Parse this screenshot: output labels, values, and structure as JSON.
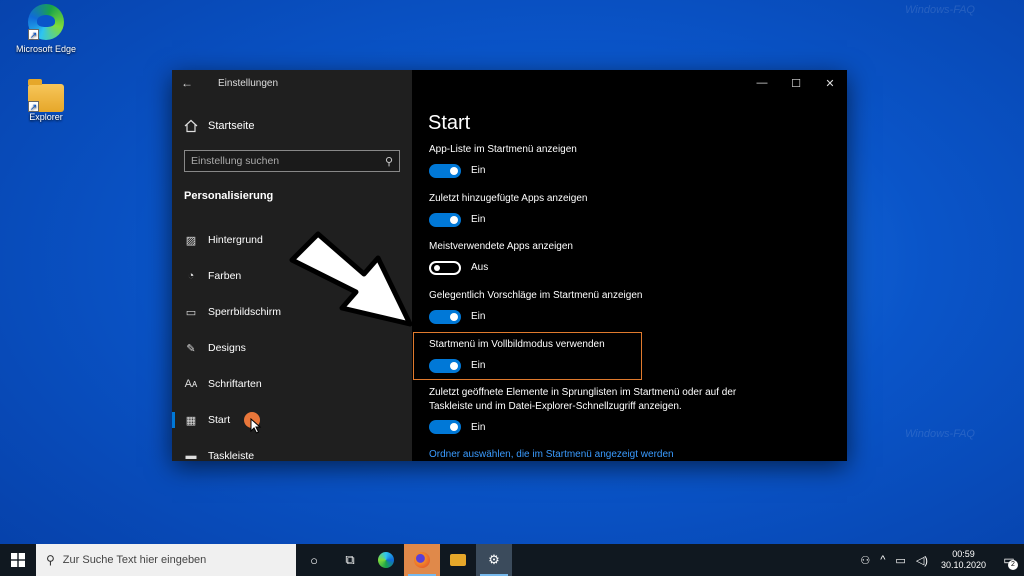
{
  "desktop": {
    "icons": [
      {
        "label": "Microsoft Edge"
      },
      {
        "label": "Explorer"
      }
    ],
    "watermark": "Windows-FAQ"
  },
  "window": {
    "title": "Einstellungen",
    "controls": {
      "minimize": "—",
      "maximize": "☐",
      "close": "✕"
    }
  },
  "sidebar": {
    "home_label": "Startseite",
    "search_placeholder": "Einstellung suchen",
    "section_title": "Personalisierung",
    "items": [
      {
        "label": "Hintergrund",
        "icon": "image-icon"
      },
      {
        "label": "Farben",
        "icon": "palette-icon"
      },
      {
        "label": "Sperrbildschirm",
        "icon": "lock-screen-icon"
      },
      {
        "label": "Designs",
        "icon": "brush-icon"
      },
      {
        "label": "Schriftarten",
        "icon": "font-icon"
      },
      {
        "label": "Start",
        "icon": "start-icon",
        "active": true
      },
      {
        "label": "Taskleiste",
        "icon": "taskbar-icon"
      }
    ]
  },
  "content": {
    "page_title": "Start",
    "settings": [
      {
        "label": "App-Liste im Startmenü anzeigen",
        "state": "Ein",
        "on": true
      },
      {
        "label": "Zuletzt hinzugefügte Apps anzeigen",
        "state": "Ein",
        "on": true
      },
      {
        "label": "Meistverwendete Apps anzeigen",
        "state": "Aus",
        "on": false
      },
      {
        "label": "Gelegentlich Vorschläge im Startmenü anzeigen",
        "state": "Ein",
        "on": true
      },
      {
        "label": "Startmenü im Vollbildmodus verwenden",
        "state": "Ein",
        "on": true
      },
      {
        "label": "Zuletzt geöffnete Elemente in Sprunglisten im Startmenü oder auf der Taskleiste und im Datei-Explorer-Schnellzugriff anzeigen.",
        "state": "Ein",
        "on": true
      }
    ],
    "link": "Ordner auswählen, die im Startmenü angezeigt werden"
  },
  "taskbar": {
    "search_placeholder": "Zur Suche Text hier eingeben",
    "time": "00:59",
    "date": "30.10.2020",
    "notification_count": "2"
  },
  "colors": {
    "accent": "#0078d7",
    "highlight_border": "#e07a2d",
    "link": "#3a9bff"
  }
}
